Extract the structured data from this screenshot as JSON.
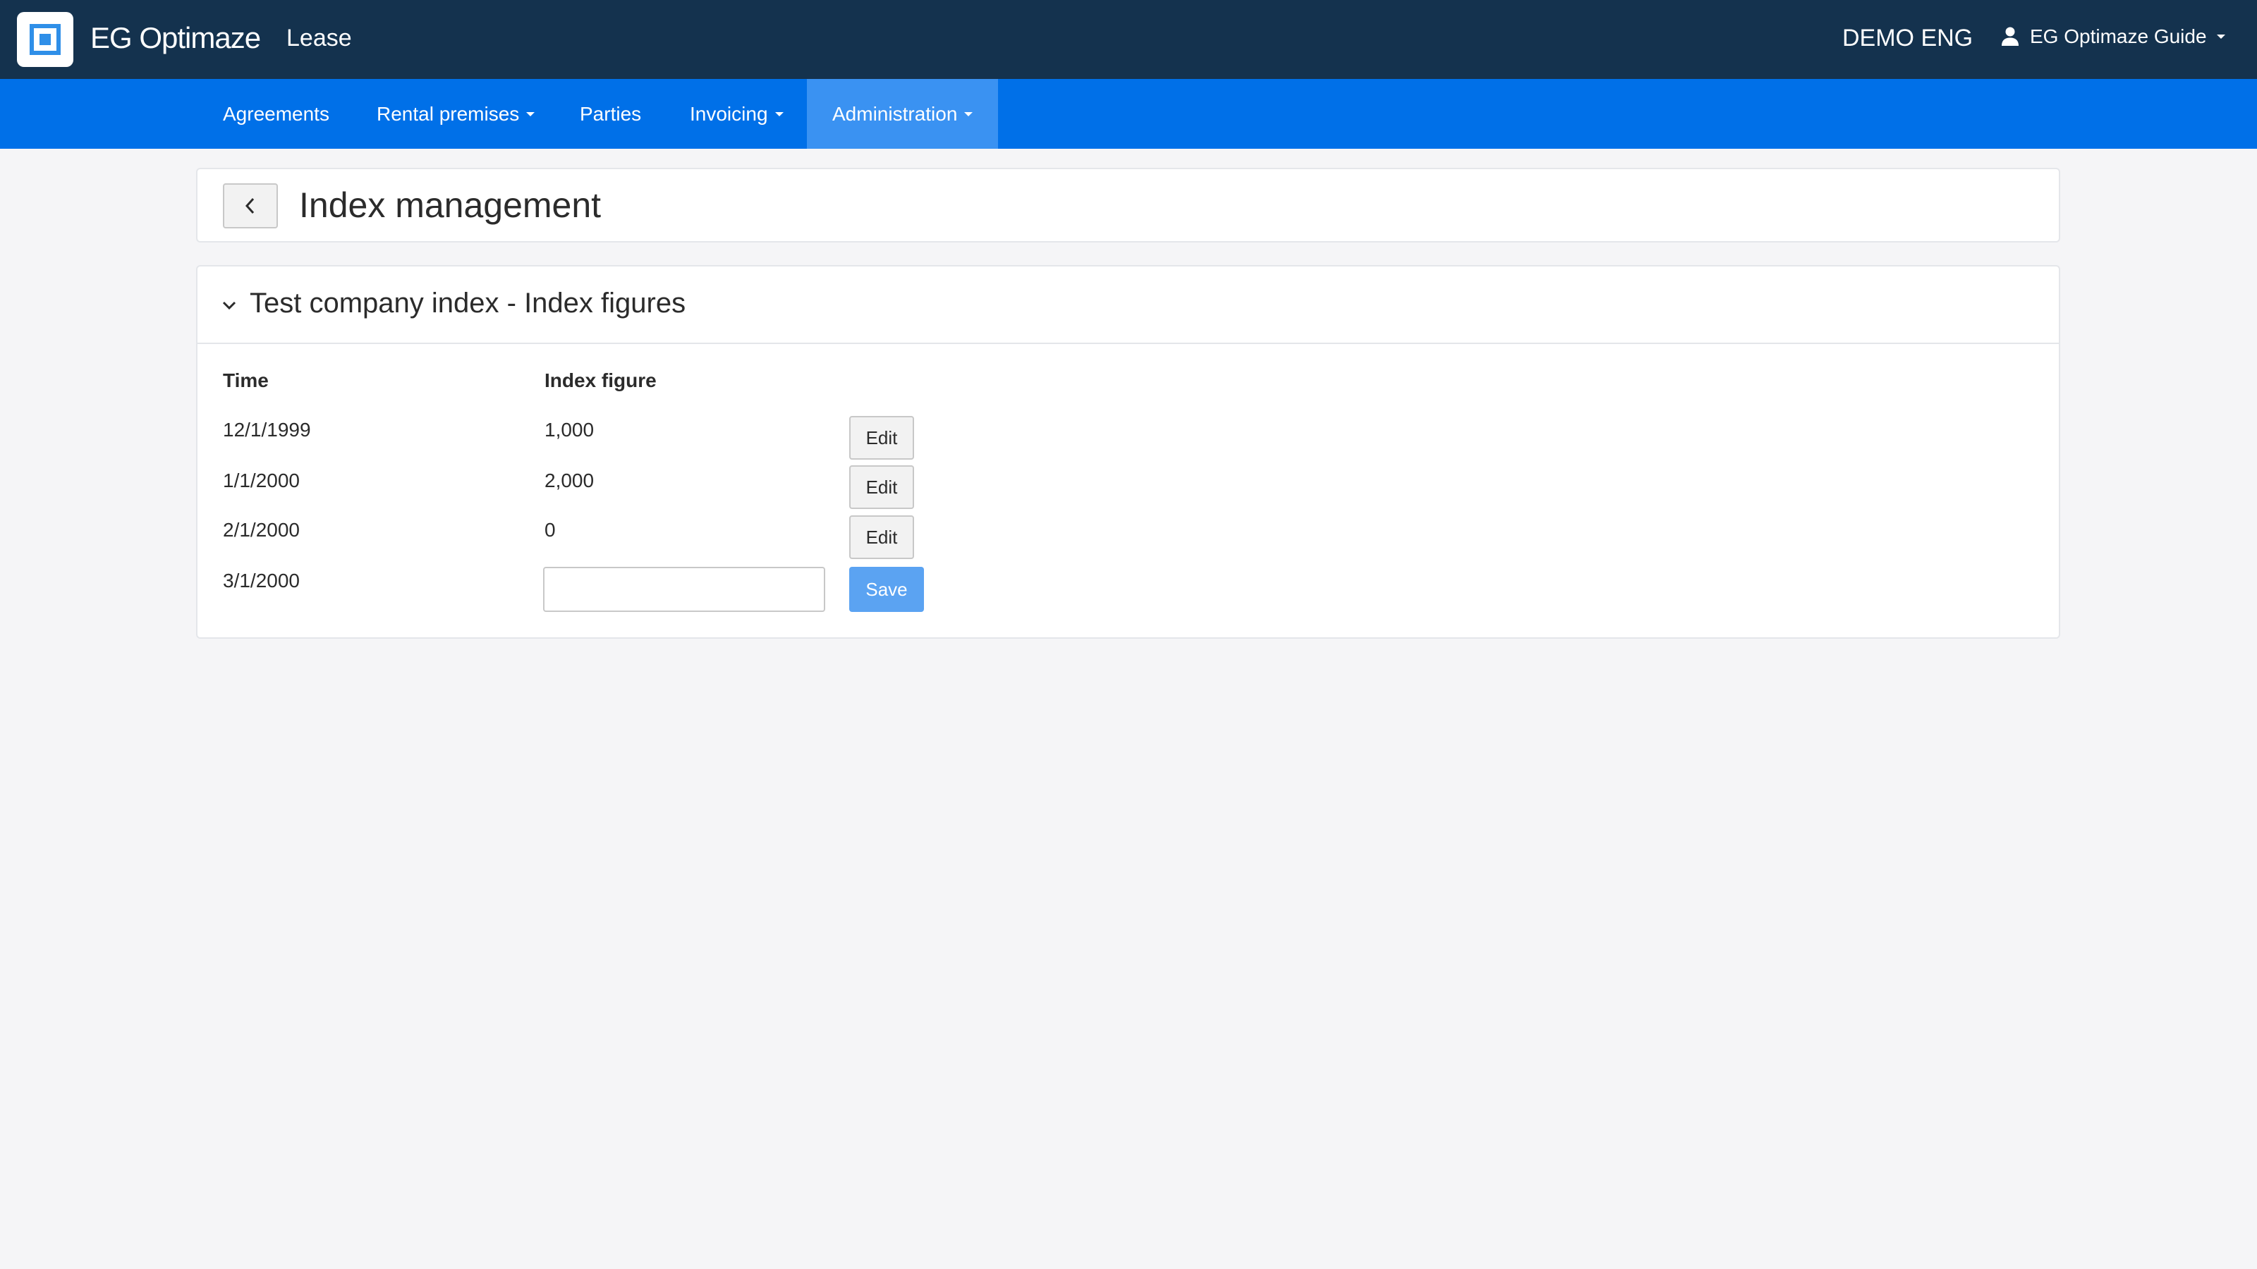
{
  "header": {
    "brand": "EG Optimaze",
    "module": "Lease",
    "tenant": "DEMO ENG",
    "user": "EG Optimaze Guide"
  },
  "nav": {
    "items": [
      {
        "label": "Agreements"
      },
      {
        "label": "Rental premises"
      },
      {
        "label": "Parties"
      },
      {
        "label": "Invoicing"
      },
      {
        "label": "Administration"
      }
    ]
  },
  "page": {
    "title": "Index management"
  },
  "section": {
    "title": "Test company index - Index figures",
    "columns": {
      "time": "Time",
      "index_figure": "Index figure"
    },
    "rows": [
      {
        "time": "12/1/1999",
        "figure": "1,000",
        "action": "Edit"
      },
      {
        "time": "1/1/2000",
        "figure": "2,000",
        "action": "Edit"
      },
      {
        "time": "2/1/2000",
        "figure": "0",
        "action": "Edit"
      }
    ],
    "new_row": {
      "time": "3/1/2000",
      "value": "",
      "action": "Save"
    }
  },
  "colors": {
    "header_bg": "#14324e",
    "nav_bg": "#0070e8",
    "nav_active_bg": "#3a92f2",
    "save_bg": "#5ba3f2"
  }
}
